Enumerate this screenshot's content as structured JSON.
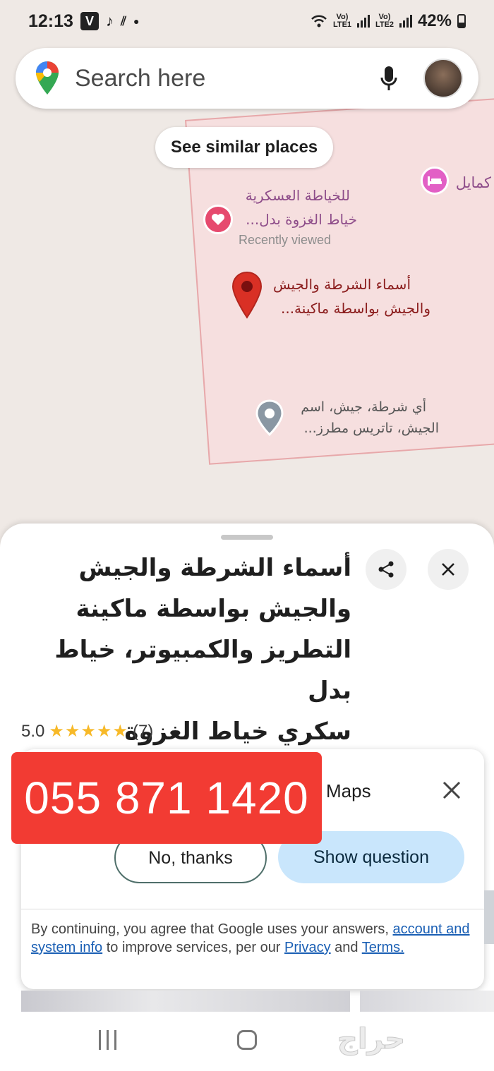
{
  "status_bar": {
    "time": "12:13",
    "lte1": "Vo) LTE1",
    "lte2": "Vo) LTE2",
    "battery": "42%"
  },
  "search": {
    "placeholder": "Search here"
  },
  "map": {
    "similar_chip": "See similar places",
    "labels": {
      "hotel": "كمايل",
      "saved_place_line1": "للخياطة العسكرية",
      "saved_place_line2": "خياط الغزوة بدل...",
      "recently_viewed": "Recently viewed",
      "selected_place_line1": "أسماء الشرطة والجيش",
      "selected_place_line2": "والجيش بواسطة ماكينة...",
      "other_place_line1": "أي شرطة، جيش، اسم",
      "other_place_line2": "الجيش، تاتريس مطرز..."
    }
  },
  "place": {
    "title_lines": [
      "أسماء الشرطة والجيش",
      "والجيش بواسطة ماكينة",
      "التطريز والكمبيوتر، خياط بدل",
      "سكري خياط الغزوة خيبر,اس..."
    ],
    "rating": "5.0",
    "stars": "★★★★★",
    "review_count": "(7)"
  },
  "survey": {
    "title_fragment": "Maps",
    "no_label": "No, thanks",
    "show_label": "Show question",
    "disclaimer_part1": "By continuing, you agree that Google uses your answers, ",
    "disclaimer_link1": "account and system info",
    "disclaimer_part2": " to improve services, per our ",
    "disclaimer_link2": "Privacy",
    "disclaimer_part3": " and ",
    "disclaimer_link3": "Terms."
  },
  "overlay": {
    "phone_number": "055 871 1420"
  },
  "watermark": {
    "text": "حراج"
  },
  "colors": {
    "map_bg": "#efe9e5",
    "region_fill": "#f6dfdf",
    "pin_red": "#d93025",
    "banner_red": "#f23b33",
    "star_yellow": "#f7b928",
    "link_blue": "#1a5fb4"
  }
}
